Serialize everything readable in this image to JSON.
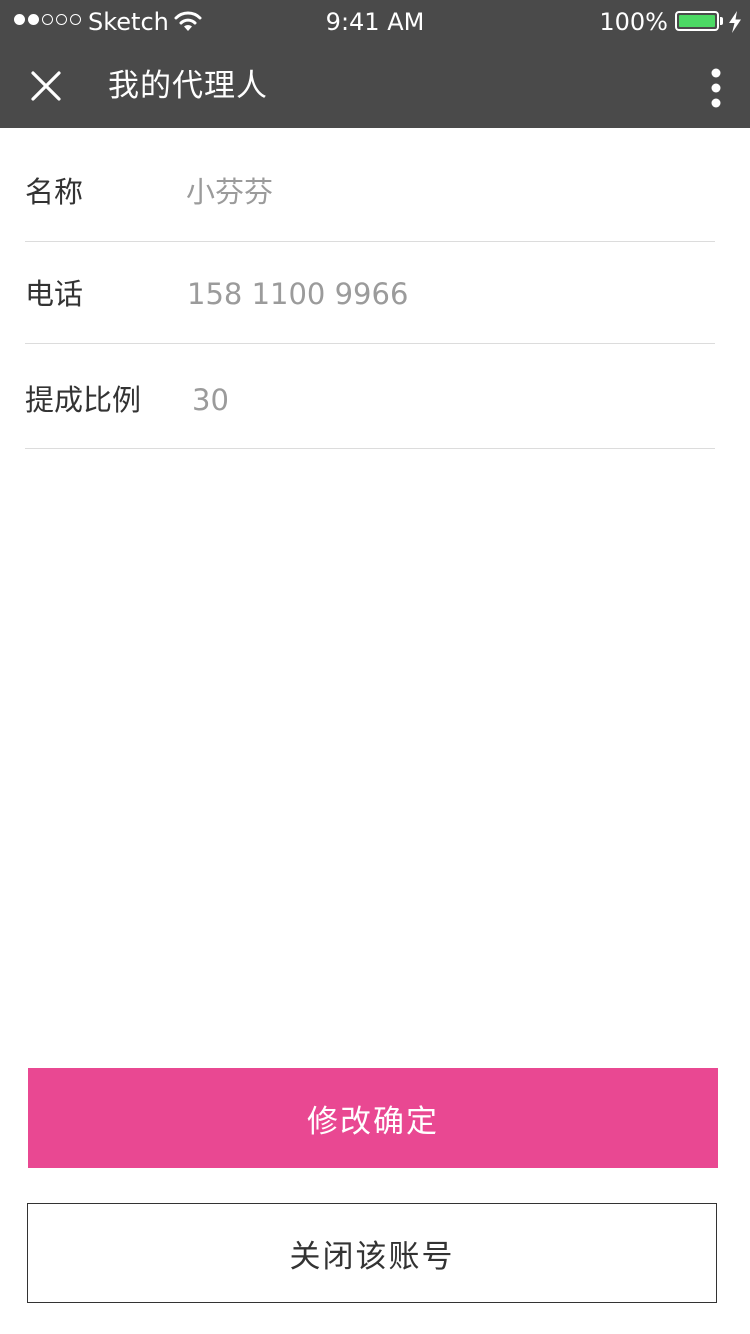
{
  "status_bar": {
    "carrier": "Sketch",
    "time": "9:41 AM",
    "battery_percent": "100%",
    "signal_icon": "signal-dots-icon",
    "wifi_icon": "wifi-icon",
    "battery_icon": "battery-icon",
    "charging_icon": "charging-bolt-icon",
    "battery_level": 1.0,
    "battery_color": "#4cd964"
  },
  "nav": {
    "title": "我的代理人",
    "close_icon": "close-icon",
    "more_icon": "more-vertical-icon",
    "background": "#4a4a4a"
  },
  "form": {
    "name_label": "名称",
    "name_value": "小芬芬",
    "phone_label": "电话",
    "phone_value": "158 1100 9966",
    "commission_label": "提成比例",
    "commission_value": "30"
  },
  "actions": {
    "confirm_label": "修改确定",
    "confirm_color": "#e94892",
    "close_account_label": "关闭该账号"
  }
}
